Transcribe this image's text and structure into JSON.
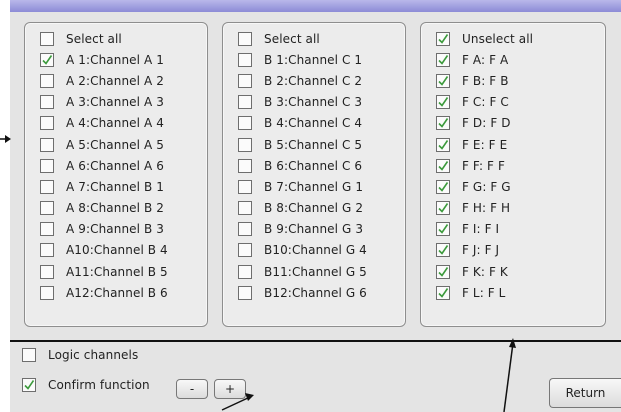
{
  "panel_a": {
    "items": [
      {
        "label": "Select all",
        "checked": false
      },
      {
        "label": "A 1:Channel A 1",
        "checked": true
      },
      {
        "label": "A 2:Channel A 2",
        "checked": false
      },
      {
        "label": "A 3:Channel A 3",
        "checked": false
      },
      {
        "label": "A 4:Channel A 4",
        "checked": false
      },
      {
        "label": "A 5:Channel A 5",
        "checked": false
      },
      {
        "label": "A 6:Channel A 6",
        "checked": false
      },
      {
        "label": "A 7:Channel B 1",
        "checked": false
      },
      {
        "label": "A 8:Channel B 2",
        "checked": false
      },
      {
        "label": "A 9:Channel B 3",
        "checked": false
      },
      {
        "label": "A10:Channel B 4",
        "checked": false
      },
      {
        "label": "A11:Channel B 5",
        "checked": false
      },
      {
        "label": "A12:Channel B 6",
        "checked": false
      }
    ]
  },
  "panel_b": {
    "items": [
      {
        "label": "Select all",
        "checked": false
      },
      {
        "label": "B 1:Channel C 1",
        "checked": false
      },
      {
        "label": "B 2:Channel C 2",
        "checked": false
      },
      {
        "label": "B 3:Channel C 3",
        "checked": false
      },
      {
        "label": "B 4:Channel C 4",
        "checked": false
      },
      {
        "label": "B 5:Channel C 5",
        "checked": false
      },
      {
        "label": "B 6:Channel C 6",
        "checked": false
      },
      {
        "label": "B 7:Channel G 1",
        "checked": false
      },
      {
        "label": "B 8:Channel G 2",
        "checked": false
      },
      {
        "label": "B 9:Channel G 3",
        "checked": false
      },
      {
        "label": "B10:Channel G 4",
        "checked": false
      },
      {
        "label": "B11:Channel G 5",
        "checked": false
      },
      {
        "label": "B12:Channel G 6",
        "checked": false
      }
    ]
  },
  "panel_f": {
    "items": [
      {
        "label": "Unselect all",
        "checked": true
      },
      {
        "label": "F A: F A",
        "checked": true
      },
      {
        "label": "F B: F B",
        "checked": true
      },
      {
        "label": "F C: F C",
        "checked": true
      },
      {
        "label": "F D: F D",
        "checked": true
      },
      {
        "label": "F E: F E",
        "checked": true
      },
      {
        "label": "F F: F F",
        "checked": true
      },
      {
        "label": "F G: F G",
        "checked": true
      },
      {
        "label": "F H: F H",
        "checked": true
      },
      {
        "label": "F I: F I",
        "checked": true
      },
      {
        "label": "F J: F J",
        "checked": true
      },
      {
        "label": "F K: F K",
        "checked": true
      },
      {
        "label": "F L: F L",
        "checked": true
      }
    ]
  },
  "bottom": {
    "logic_channels": {
      "label": "Logic channels",
      "checked": false
    },
    "confirm_function": {
      "label": "Confirm function",
      "checked": true
    },
    "minus_label": "-",
    "plus_label": "+",
    "return_label": "Return"
  },
  "colors": {
    "check_green": "#3c9a3c",
    "panel_bg": "#ececec",
    "window_bg": "#e4e4e4",
    "title_bar": "#9d9cdd"
  },
  "icons": {
    "checkbox_tick": "check-icon",
    "annotation_arrows": "arrow-icon"
  }
}
